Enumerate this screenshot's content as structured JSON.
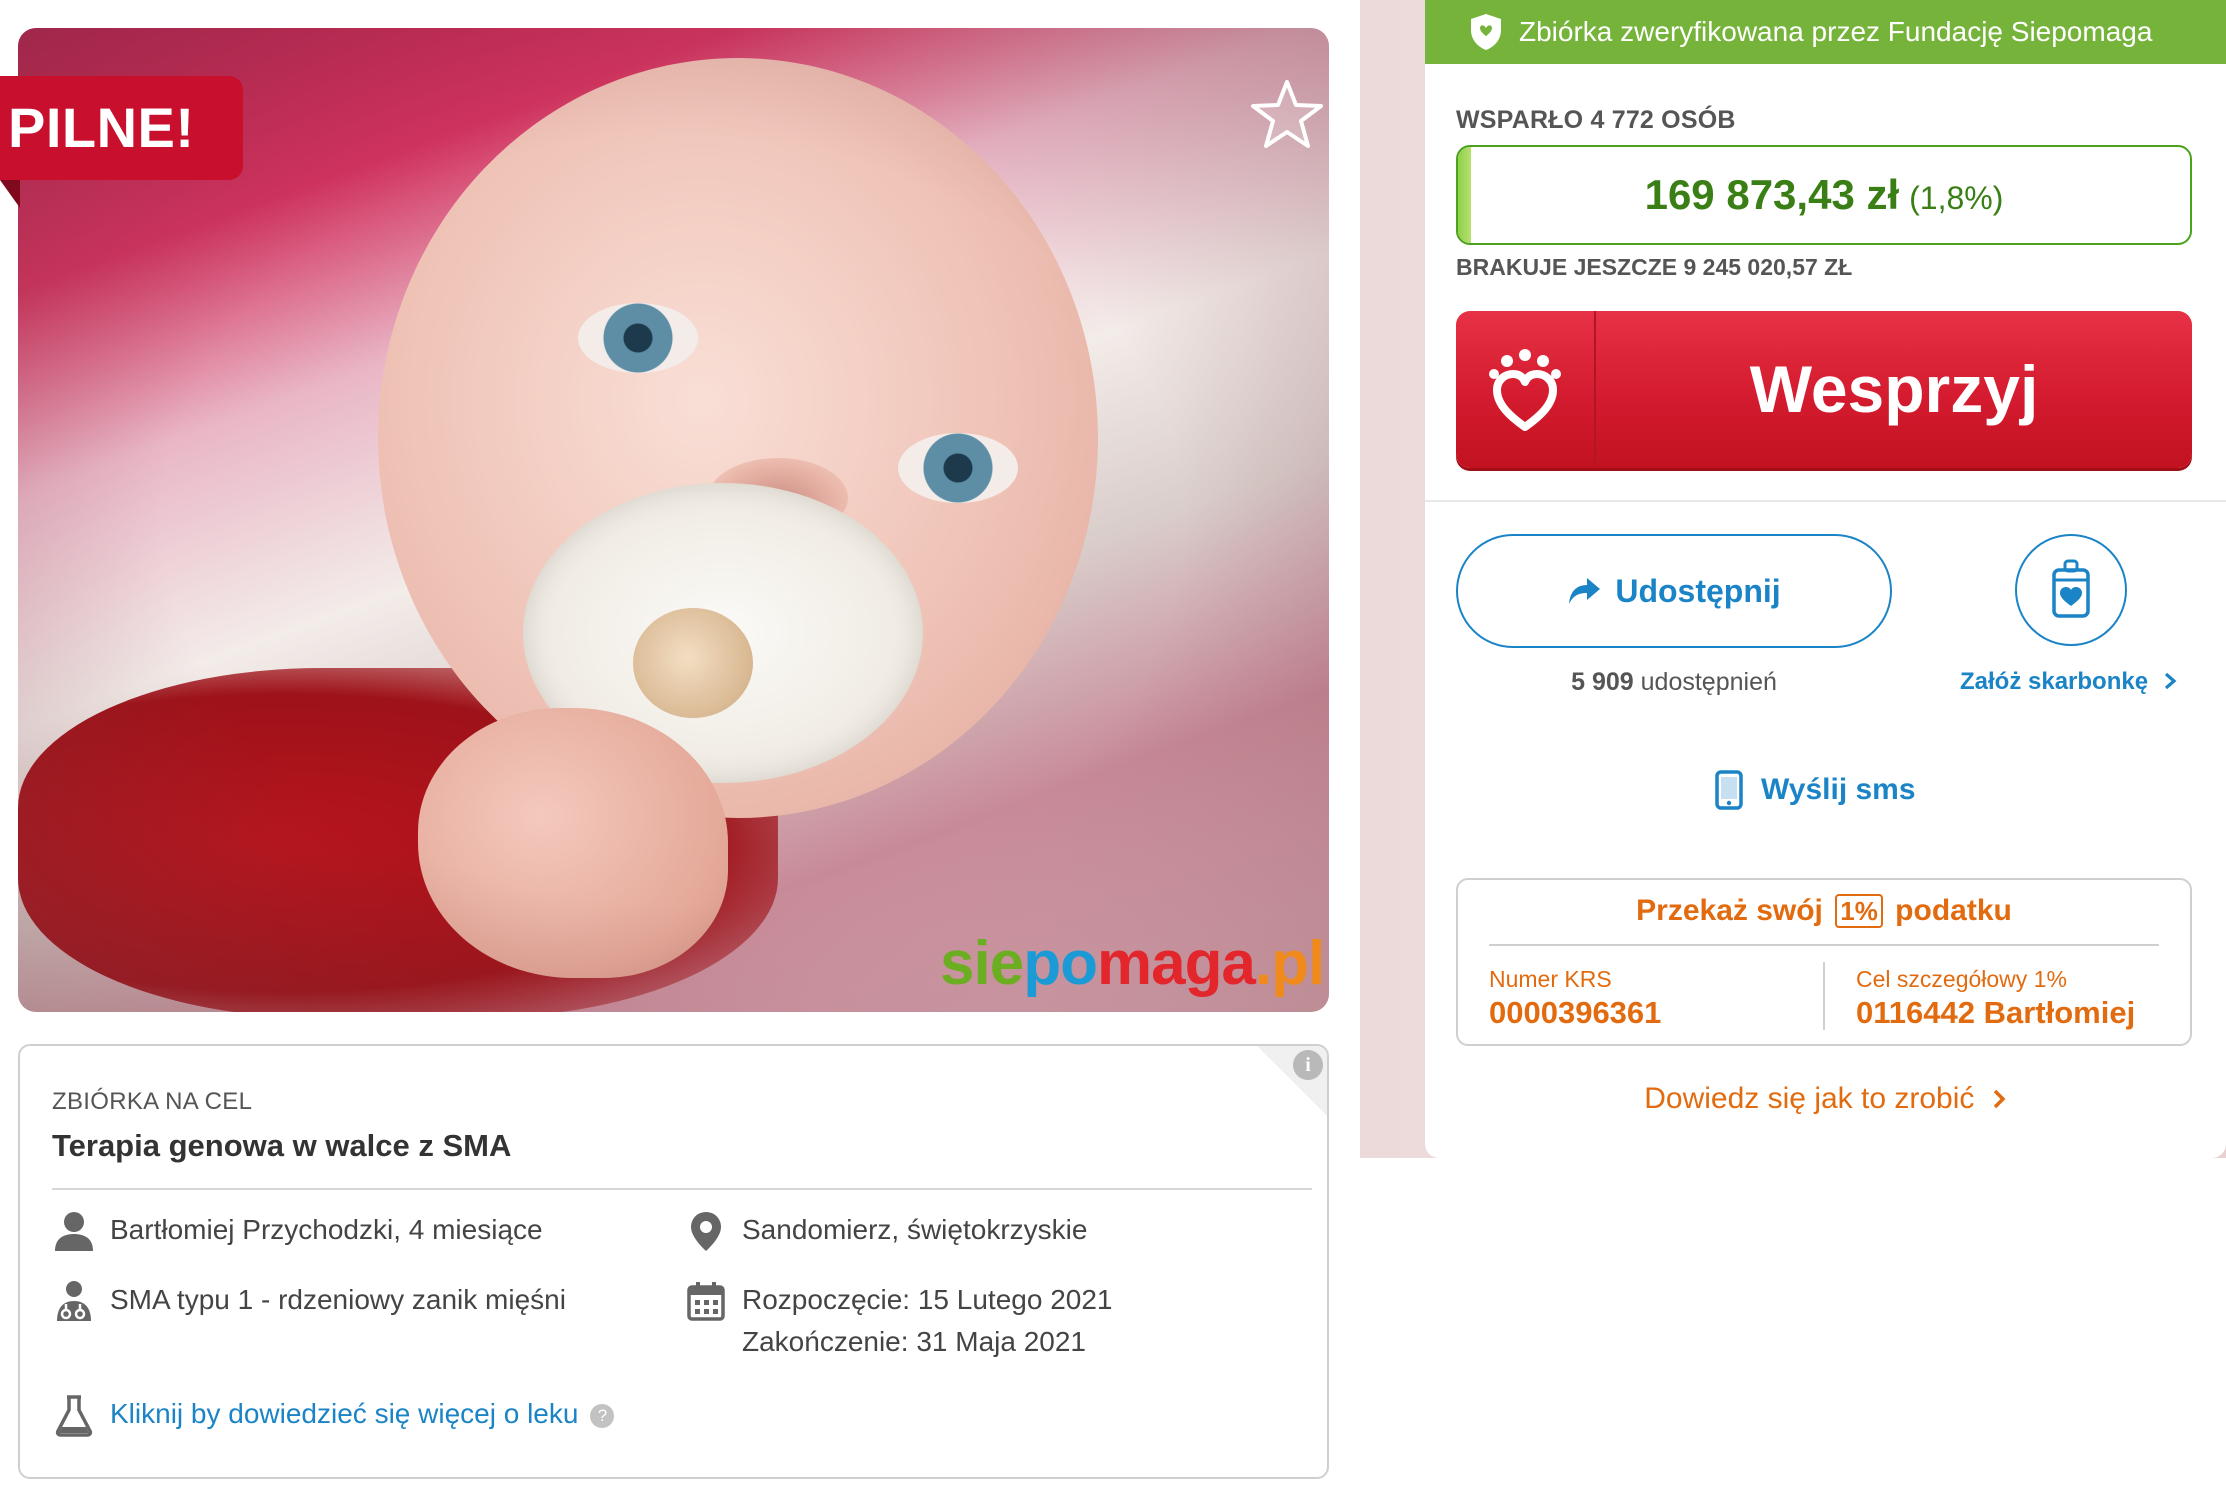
{
  "photo": {
    "urgent_badge": "PILNE!",
    "brand": {
      "part1": "sie",
      "part2": "po",
      "part3": "maga",
      "part4": ".pl"
    }
  },
  "info": {
    "label": "ZBIÓRKA NA CEL",
    "title": "Terapia genowa w walce z SMA",
    "person": "Bartłomiej Przychodzki, 4 miesiące",
    "location": "Sandomierz, świętokrzyskie",
    "disease": "SMA typu 1 - rdzeniowy zanik mięśni",
    "start": "Rozpoczęcie: 15 Lutego 2021",
    "end": "Zakończenie: 31 Maja 2021",
    "drug_link": "Kliknij by dowiedzieć się więcej o leku",
    "info_icon": "i",
    "help_icon": "?"
  },
  "panel": {
    "verified_text": "Zbiórka zweryfikowana przez Fundację Siepomaga",
    "supported_text": "WSPARŁO 4 772 OSÓB",
    "amount": "169 873,43 zł",
    "percent": "(1,8%)",
    "progress_percent": 1.8,
    "remaining_text": "BRAKUJE JESZCZE 9 245 020,57 ZŁ",
    "support_button": "Wesprzyj",
    "share_button": "Udostępnij",
    "share_count_number": "5 909",
    "share_count_label": "udostępnień",
    "piggy_link": "Załóż skarbonkę",
    "sms_link": "Wyślij sms",
    "tax": {
      "title_before": "Przekaż swój",
      "title_badge": "1%",
      "title_after": "podatku",
      "krs_label": "Numer KRS",
      "krs_value": "0000396361",
      "goal_label": "Cel szczegółowy 1%",
      "goal_value": "0116442 Bartłomiej"
    },
    "howto_link": "Dowiedz się jak to zrobić"
  },
  "colors": {
    "verified_green": "#76b33a",
    "amount_green": "#3a7f16",
    "support_red": "#d41b2f",
    "link_blue": "#1b84c6",
    "tax_orange": "#e26b10"
  },
  "icons": [
    "star-icon",
    "person-icon",
    "location-pin-icon",
    "doctor-icon",
    "calendar-icon",
    "flask-icon",
    "help-circle-icon",
    "info-icon",
    "shield-icon",
    "heart-hand-icon",
    "share-arrow-icon",
    "piggy-bank-icon",
    "phone-icon",
    "chevron-right-icon"
  ]
}
